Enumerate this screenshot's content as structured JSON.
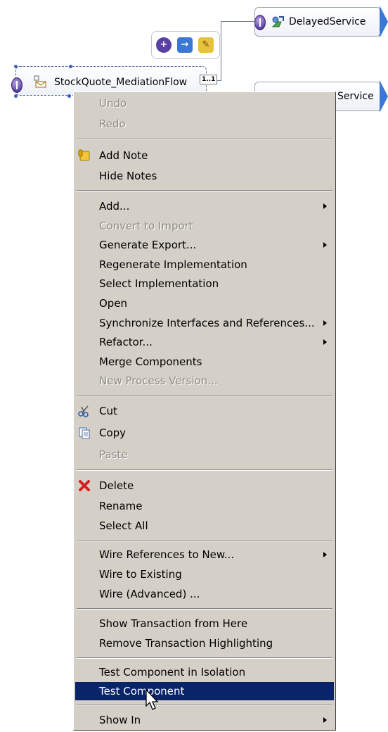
{
  "diagram": {
    "main_component": {
      "label": "StockQuote_MediationFlow"
    },
    "delayed_service": {
      "label": "DelayedService"
    },
    "second_service": {
      "label": "Service"
    },
    "wire_badge": "1..1",
    "colors": {
      "interface": "#5a3fa4",
      "reference_arrow": "#3b78d4",
      "selection": "#0a246a"
    }
  },
  "popup_toolbar": {
    "icons": [
      "add-interface-icon",
      "add-reference-icon",
      "add-note-icon"
    ]
  },
  "context_menu": {
    "groups": [
      {
        "items": [
          {
            "label": "Undo",
            "disabled": true
          },
          {
            "label": "Redo",
            "disabled": true
          }
        ]
      },
      {
        "items": [
          {
            "label": "Add Note",
            "icon": "note-icon"
          },
          {
            "label": "Hide Notes"
          }
        ]
      },
      {
        "items": [
          {
            "label": "Add...",
            "submenu": true
          },
          {
            "label": "Convert to Import",
            "disabled": true
          },
          {
            "label": "Generate Export...",
            "submenu": true
          },
          {
            "label": "Regenerate Implementation"
          },
          {
            "label": "Select Implementation"
          },
          {
            "label": "Open"
          },
          {
            "label": "Synchronize Interfaces and References...",
            "submenu": true
          },
          {
            "label": "Refactor...",
            "submenu": true
          },
          {
            "label": "Merge Components"
          },
          {
            "label": "New Process Version...",
            "disabled": true
          }
        ]
      },
      {
        "items": [
          {
            "label": "Cut",
            "icon": "scissors-icon"
          },
          {
            "label": "Copy",
            "icon": "copy-icon"
          },
          {
            "label": "Paste",
            "disabled": true
          }
        ]
      },
      {
        "items": [
          {
            "label": "Delete",
            "icon": "delete-x-icon"
          },
          {
            "label": "Rename"
          },
          {
            "label": "Select All"
          }
        ]
      },
      {
        "items": [
          {
            "label": "Wire References to New...",
            "submenu": true
          },
          {
            "label": "Wire to Existing"
          },
          {
            "label": "Wire (Advanced) ..."
          }
        ]
      },
      {
        "items": [
          {
            "label": "Show Transaction from Here"
          },
          {
            "label": "Remove Transaction Highlighting"
          }
        ]
      },
      {
        "items": [
          {
            "label": "Test Component in Isolation"
          },
          {
            "label": "Test Component",
            "selected": true
          }
        ]
      },
      {
        "items": [
          {
            "label": "Show In",
            "submenu": true
          }
        ]
      }
    ]
  }
}
